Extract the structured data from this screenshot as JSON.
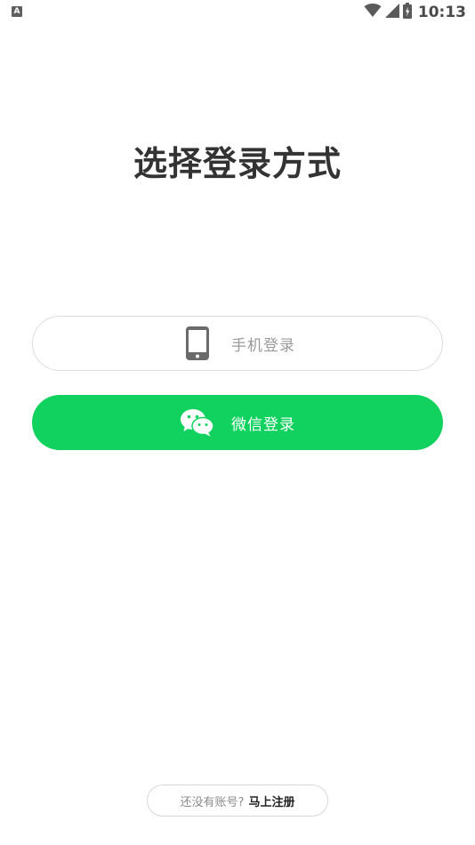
{
  "status_bar": {
    "left_icon": "A",
    "time": "10:13",
    "icons": [
      "wifi-icon",
      "cell-signal-icon",
      "battery-icon"
    ]
  },
  "page": {
    "title": "选择登录方式"
  },
  "login_options": {
    "phone": {
      "label": "手机登录",
      "icon": "smartphone-icon"
    },
    "wechat": {
      "label": "微信登录",
      "icon": "wechat-icon",
      "color": "#12d25f"
    }
  },
  "register": {
    "prompt": "还没有账号?",
    "link": "马上注册"
  }
}
